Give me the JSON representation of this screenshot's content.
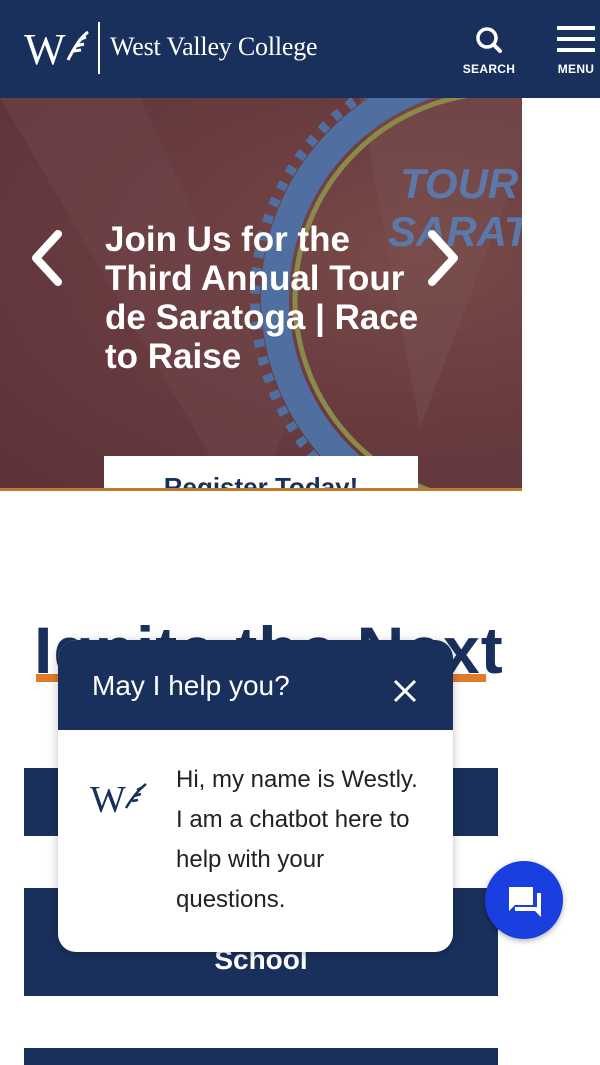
{
  "header": {
    "college_name": "West Valley College",
    "search_label": "SEARCH",
    "menu_label": "MENU"
  },
  "hero": {
    "background_text_1": "TOUR",
    "background_text_2": "SARAT",
    "title": "Join Us for the Third Annual Tour de Saratoga | Race to Raise",
    "cta_label": "Register Today!"
  },
  "section": {
    "heading": "Ignite the Next",
    "block2_label": "School"
  },
  "chat": {
    "title": "May I help you?",
    "message": "Hi, my name is Westly. I am a chatbot here to help with your questions."
  },
  "colors": {
    "navy": "#1a305c",
    "accent_orange": "#e07b2a",
    "chat_fab": "#1a3fe0"
  }
}
